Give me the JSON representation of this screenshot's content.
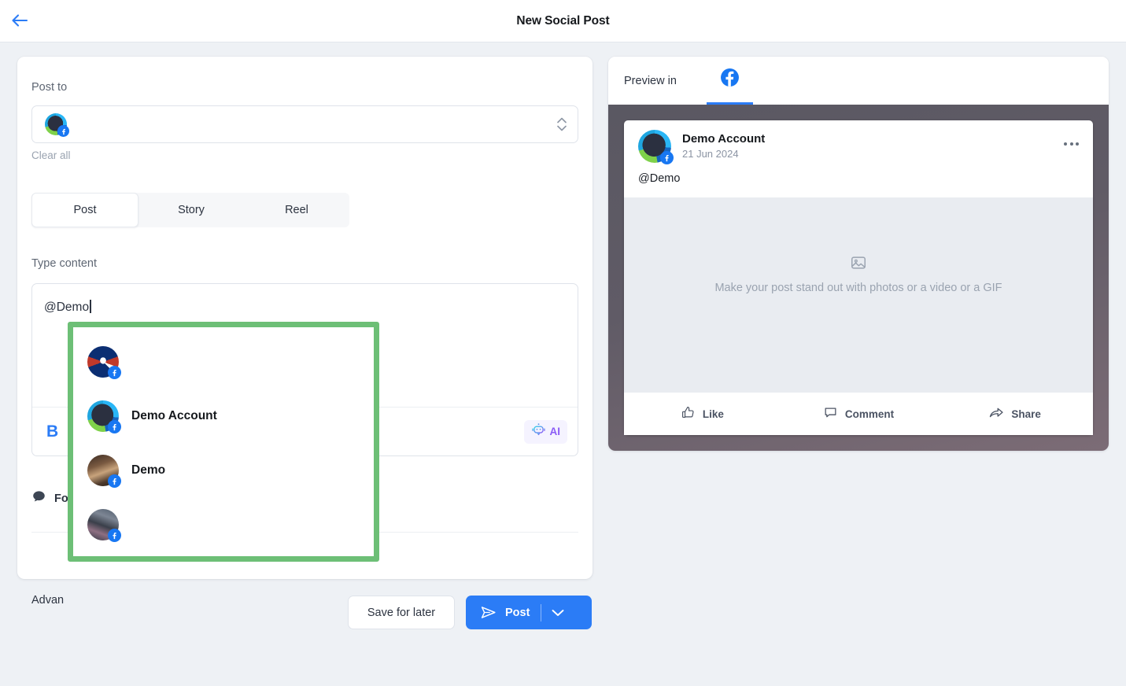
{
  "header": {
    "back_icon": "arrow-left-icon",
    "title": "New Social Post"
  },
  "composer": {
    "post_to_label": "Post to",
    "selected_account_icon": "facebook-account-avatar",
    "stepper_icon": "chevron-up-down-icon",
    "clear_all_label": "Clear all",
    "tabs": [
      {
        "label": "Post",
        "active": true
      },
      {
        "label": "Story",
        "active": false
      },
      {
        "label": "Reel",
        "active": false
      }
    ],
    "content_label": "Type content",
    "content_value": "@Demo",
    "toolbar": {
      "bold_label": "B",
      "ai_label": "AI",
      "ai_icon": "robot-icon"
    },
    "first_comment_label": "Fo",
    "first_comment_icon": "chat-bubble-icon",
    "advanced_label": "Advan"
  },
  "mention_dropdown": {
    "border_color": "#6dbf76",
    "items": [
      {
        "name": "",
        "avatar": "nasa-badge-avatar",
        "network": "facebook"
      },
      {
        "name": "Demo Account",
        "avatar": "eye-logo-avatar",
        "network": "facebook"
      },
      {
        "name": "Demo",
        "avatar": "person-photo-avatar",
        "network": "facebook"
      },
      {
        "name": "",
        "avatar": "group-photo-avatar",
        "network": "facebook"
      }
    ]
  },
  "actions": {
    "save_label": "Save for later",
    "post_label": "Post",
    "post_icon": "send-icon",
    "post_chevron_icon": "chevron-down-icon"
  },
  "preview": {
    "label": "Preview in",
    "active_network": "facebook",
    "network_icon": "facebook-icon",
    "post": {
      "author": "Demo Account",
      "date": "21 Jun 2024",
      "body": "@Demo",
      "menu_icon": "ellipsis-icon",
      "media_placeholder_icon": "image-icon",
      "media_placeholder_text": "Make your post stand out with photos or a video or a GIF",
      "actions": [
        {
          "label": "Like",
          "icon": "thumbs-up-icon"
        },
        {
          "label": "Comment",
          "icon": "comment-icon"
        },
        {
          "label": "Share",
          "icon": "share-icon"
        }
      ]
    }
  },
  "colors": {
    "accent_blue": "#2b7cf6",
    "facebook_blue": "#1877f2",
    "highlight_green": "#6dbf76",
    "ai_purple": "#8b5cf6",
    "page_bg": "#eef1f5"
  }
}
